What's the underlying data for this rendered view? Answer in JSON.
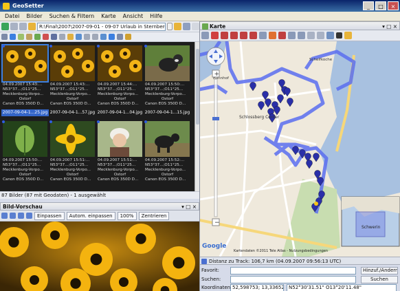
{
  "window": {
    "title": "GeoSetter"
  },
  "menu": [
    "Datei",
    "Bilder",
    "Suchen & Filtern",
    "Karte",
    "Ansicht",
    "Hilfe"
  ],
  "toolbar": {
    "path": "R:\\Final\\2007\\2007-09-01 - 09-07 Urlaub in Sternberg\\2007-09-0"
  },
  "thumbnails": [
    {
      "date": "04.09.2007 15:43:...",
      "coords": "N53°37...;O11°25...",
      "region": "Mecklenburg-Vorpo...",
      "place": "Ostorf",
      "camera": "Canon EOS 350D D...",
      "name": "2007-09-04-1...25.jpg",
      "selected": true,
      "geo": true,
      "scene": "flowers"
    },
    {
      "date": "04.09.2007 15:43:...",
      "coords": "N53°37...;O11°25...",
      "region": "Mecklenburg-Vorpo...",
      "place": "Ostorf",
      "camera": "Canon EOS 350D D...",
      "name": "2007-09-04-1...57.jpg",
      "selected": false,
      "geo": true,
      "scene": "flowers"
    },
    {
      "date": "04.09.2007 15:44:...",
      "coords": "N53°37...;O11°25...",
      "region": "Mecklenburg-Vorpo...",
      "place": "Ostorf",
      "camera": "Canon EOS 350D D...",
      "name": "2007-09-04-1...04.jpg",
      "selected": false,
      "geo": true,
      "scene": "flowers"
    },
    {
      "date": "04.09.2007 15:50:...",
      "coords": "N53°37...;O11°25...",
      "region": "Mecklenburg-Vorpo...",
      "place": "Ostorf",
      "camera": "Canon EOS 350D D...",
      "name": "2007-09-04-1...15.jpg",
      "selected": false,
      "geo": true,
      "scene": "dog"
    },
    {
      "date": "04.09.2007 15:50:...",
      "coords": "N53°37...;O11°25...",
      "region": "Mecklenburg-Vorpo...",
      "place": "Ostorf",
      "camera": "Canon EOS 350D D...",
      "name": "",
      "selected": false,
      "geo": true,
      "scene": "plant"
    },
    {
      "date": "04.09.2007 15:51:...",
      "coords": "N53°37...;O11°25...",
      "region": "Mecklenburg-Vorpo...",
      "place": "Ostorf",
      "camera": "Canon EOS 350D D...",
      "name": "",
      "selected": false,
      "geo": true,
      "scene": "yellow"
    },
    {
      "date": "04.09.2007 15:51:...",
      "coords": "N53°37...;O11°25...",
      "region": "Mecklenburg-Vorpo...",
      "place": "Ostorf",
      "camera": "Canon EOS 350D D...",
      "name": "",
      "selected": false,
      "geo": true,
      "scene": "girl"
    },
    {
      "date": "04.09.2007 15:52:...",
      "coords": "N53°37...;O11°25...",
      "region": "Mecklenburg-Vorpo...",
      "place": "Ostorf",
      "camera": "Canon EOS 350D D...",
      "name": "",
      "selected": false,
      "geo": true,
      "scene": "dog2"
    }
  ],
  "thumb_status": "87 Bilder (87 mit Geodaten) - 1 ausgewählt",
  "preview": {
    "title": "Bild-Vorschau",
    "fit_label": "Einpassen",
    "auto_fit_label": "Autom. einpassen",
    "zoom": "100%",
    "center_label": "Zentrieren"
  },
  "map": {
    "title": "Karte",
    "labels": {
      "schlossberg": "Schlossberg Center",
      "schelfkoche": "Schelfkoche",
      "bahnhof": "Bahnhof",
      "schwerin": "Schwerin",
      "copyright": "Kartendaten ©2011 Tele Atlas - Nutzungsbedingungen",
      "google": "Google"
    },
    "colors": {
      "track": "#5b6ef0",
      "marker": "#2a2fa8",
      "water": "#a8c1e0",
      "park": "#c8ddb0"
    }
  },
  "distance_status": "Distanz zu Track: 106,7 km (04.09.2007 09:56:13 UTC)",
  "form": {
    "favorite_label": "Favorit:",
    "favorite_button": "Hinzuf./Ändern...",
    "search_label": "Suchen:",
    "search_button": "Suchen",
    "coords_label": "Koordinaten:",
    "coords_value": "52,598753; 13,336523",
    "coords_dms": "N52°30'31.51\" O13°20'11.48\""
  }
}
